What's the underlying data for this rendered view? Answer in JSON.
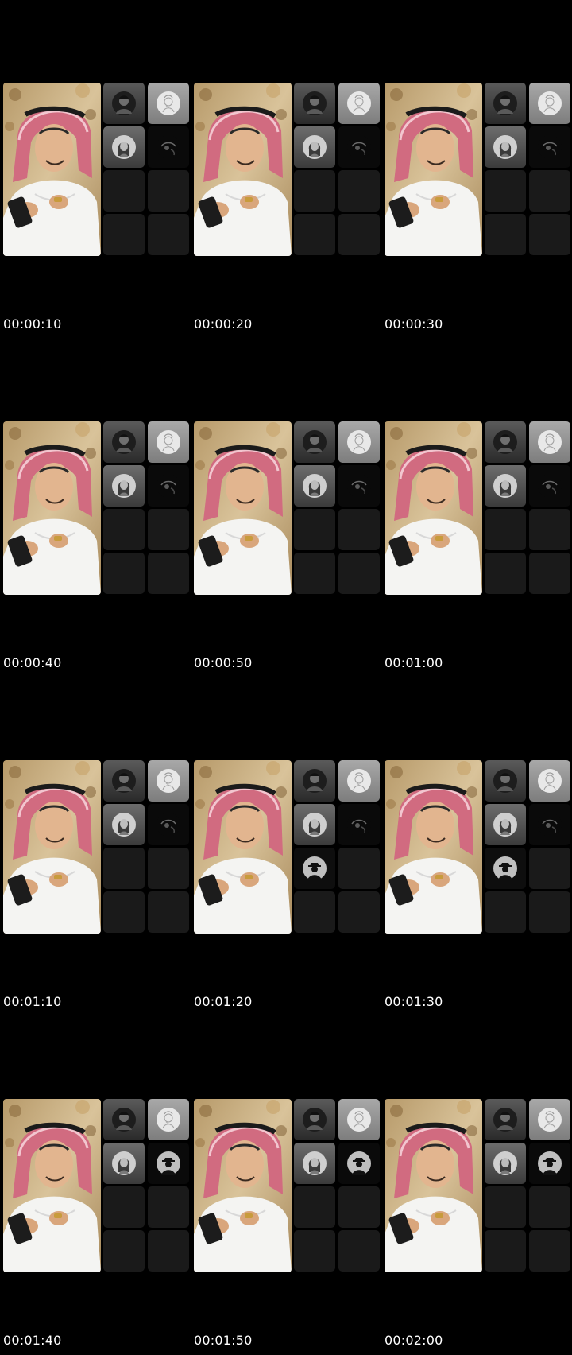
{
  "frames": [
    {
      "timestamp": "00:00:10",
      "shadow_icon_in_tile": null
    },
    {
      "timestamp": "00:00:20",
      "shadow_icon_in_tile": null
    },
    {
      "timestamp": "00:00:30",
      "shadow_icon_in_tile": null
    },
    {
      "timestamp": "00:00:40",
      "shadow_icon_in_tile": null
    },
    {
      "timestamp": "00:00:50",
      "shadow_icon_in_tile": null
    },
    {
      "timestamp": "00:01:00",
      "shadow_icon_in_tile": null
    },
    {
      "timestamp": "00:01:10",
      "shadow_icon_in_tile": null
    },
    {
      "timestamp": "00:01:20",
      "shadow_icon_in_tile": "row3-left"
    },
    {
      "timestamp": "00:01:30",
      "shadow_icon_in_tile": "row3-left"
    },
    {
      "timestamp": "00:01:40",
      "shadow_icon_in_tile": "row2-right"
    },
    {
      "timestamp": "00:01:50",
      "shadow_icon_in_tile": "row2-right"
    },
    {
      "timestamp": "00:02:00",
      "shadow_icon_in_tile": "row2-right"
    }
  ],
  "colors": {
    "background": "#000000",
    "timestamp_text": "#ffffff",
    "empty_tile": "#1a1a1a"
  },
  "icons": {
    "main_video": "person-video-thumbnail",
    "avatar_man": "male-avatar-icon",
    "avatar_sketch": "sketch-avatar-icon",
    "avatar_woman": "female-avatar-icon",
    "avatar_dark": "dark-avatar-icon",
    "avatar_shadow": "shadow-figure-icon"
  }
}
